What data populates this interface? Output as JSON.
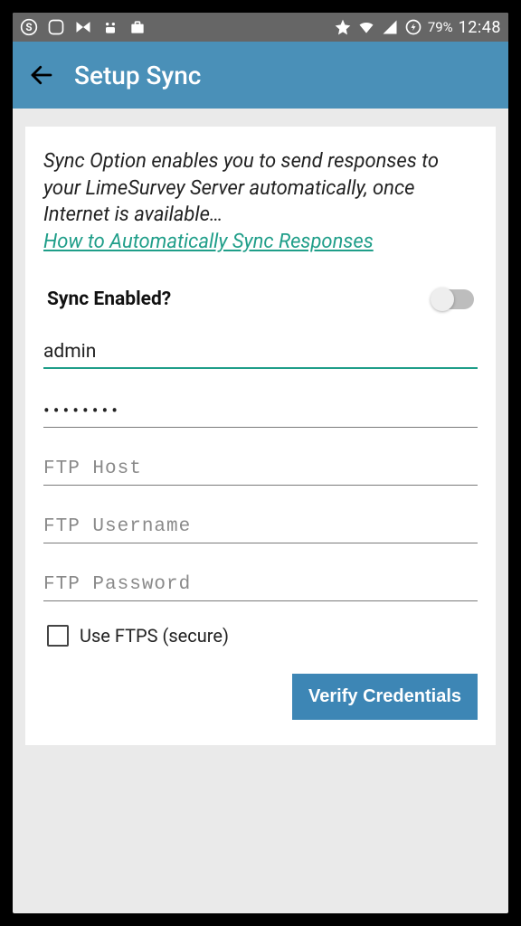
{
  "status": {
    "battery_pct": "79%",
    "time": "12:48"
  },
  "appbar": {
    "title": "Setup Sync"
  },
  "intro": {
    "text": "Sync Option enables you to send responses to your LimeSurvey Server automatically, once Internet is available…",
    "link": "How to Automatically Sync Responses"
  },
  "toggle": {
    "label": "Sync Enabled?",
    "value": false
  },
  "fields": {
    "username_value": "admin",
    "password_value": "••••••••",
    "ftp_host_placeholder": "FTP Host",
    "ftp_user_placeholder": "FTP Username",
    "ftp_pass_placeholder": "FTP Password"
  },
  "ftps": {
    "label": "Use FTPS (secure)",
    "checked": false
  },
  "buttons": {
    "verify": "Verify Credentials"
  }
}
